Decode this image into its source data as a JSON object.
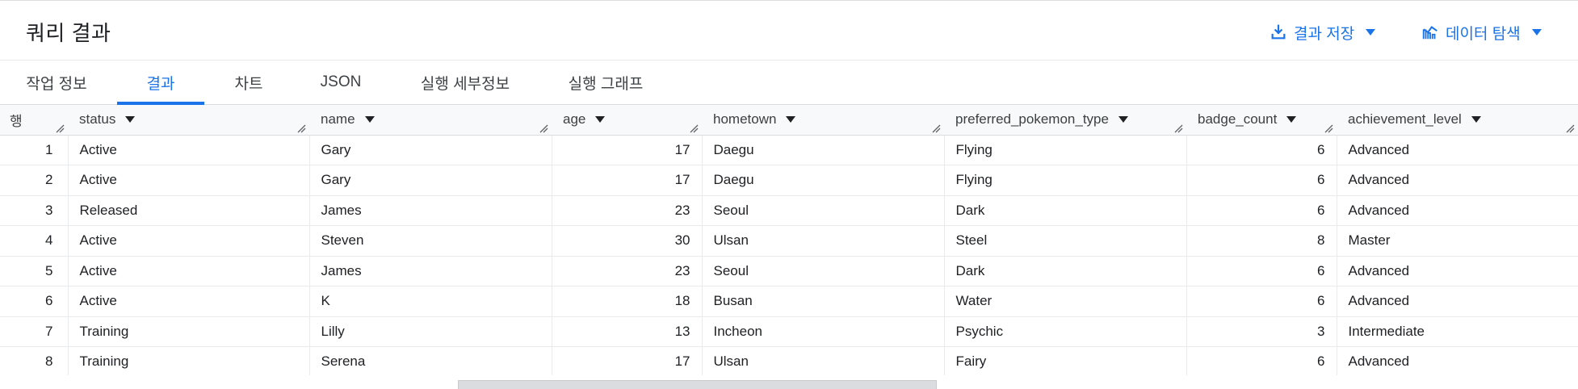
{
  "header": {
    "title": "쿼리 결과",
    "save_label": "결과 저장",
    "explore_label": "데이터 탐색"
  },
  "tabs": [
    {
      "label": "작업 정보"
    },
    {
      "label": "결과",
      "active": true
    },
    {
      "label": "차트"
    },
    {
      "label": "JSON"
    },
    {
      "label": "실행 세부정보"
    },
    {
      "label": "실행 그래프"
    }
  ],
  "table": {
    "row_header": "행",
    "columns": [
      "status",
      "name",
      "age",
      "hometown",
      "preferred_pokemon_type",
      "badge_count",
      "achievement_level"
    ],
    "rows": [
      [
        "1",
        "Active",
        "Gary",
        "17",
        "Daegu",
        "Flying",
        "6",
        "Advanced"
      ],
      [
        "2",
        "Active",
        "Gary",
        "17",
        "Daegu",
        "Flying",
        "6",
        "Advanced"
      ],
      [
        "3",
        "Released",
        "James",
        "23",
        "Seoul",
        "Dark",
        "6",
        "Advanced"
      ],
      [
        "4",
        "Active",
        "Steven",
        "30",
        "Ulsan",
        "Steel",
        "8",
        "Master"
      ],
      [
        "5",
        "Active",
        "James",
        "23",
        "Seoul",
        "Dark",
        "6",
        "Advanced"
      ],
      [
        "6",
        "Active",
        "K",
        "18",
        "Busan",
        "Water",
        "6",
        "Advanced"
      ],
      [
        "7",
        "Training",
        "Lilly",
        "13",
        "Incheon",
        "Psychic",
        "3",
        "Intermediate"
      ],
      [
        "8",
        "Training",
        "Serena",
        "17",
        "Ulsan",
        "Fairy",
        "6",
        "Advanced"
      ]
    ]
  },
  "icons": {
    "save": "download-icon",
    "explore": "chart-explore-icon",
    "caret": "caret-down-icon",
    "resize": "column-resize-icon"
  },
  "colors": {
    "accent": "#1a73e8",
    "text": "#202124",
    "header_bg": "#f8f9fa",
    "border": "#dadce0"
  }
}
